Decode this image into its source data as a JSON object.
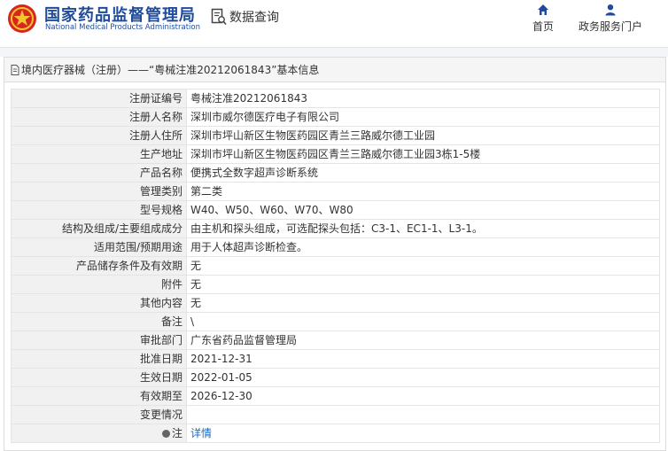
{
  "header": {
    "brand_cn": "国家药品监督管理局",
    "brand_en": "National Medical Products Administration",
    "query_label": "数据查询",
    "nav": [
      {
        "label": "首页",
        "icon": "home-icon"
      },
      {
        "label": "政务服务门户",
        "icon": "user-icon"
      }
    ]
  },
  "colors": {
    "brand": "#1f4b9a",
    "link": "#1a6ac2",
    "label_bg": "#f1f1f1"
  },
  "panel": {
    "title": "境内医疗器械（注册）——“粤械注准20212061843”基本信息"
  },
  "rows": [
    {
      "label": "注册证编号",
      "value": "粤械注准20212061843"
    },
    {
      "label": "注册人名称",
      "value": "深圳市威尔德医疗电子有限公司"
    },
    {
      "label": "注册人住所",
      "value": "深圳市坪山新区生物医药园区青兰三路威尔德工业园"
    },
    {
      "label": "生产地址",
      "value": "深圳市坪山新区生物医药园区青兰三路威尔德工业园3栋1-5楼"
    },
    {
      "label": "产品名称",
      "value": "便携式全数字超声诊断系统"
    },
    {
      "label": "管理类别",
      "value": "第二类"
    },
    {
      "label": "型号规格",
      "value": "W40、W50、W60、W70、W80"
    },
    {
      "label": "结构及组成/主要组成成分",
      "value": "由主机和探头组成，可选配探头包括：C3-1、EC1-1、L3-1。"
    },
    {
      "label": "适用范围/预期用途",
      "value": "用于人体超声诊断检查。"
    },
    {
      "label": "产品储存条件及有效期",
      "value": "无"
    },
    {
      "label": "附件",
      "value": "无"
    },
    {
      "label": "其他内容",
      "value": "无"
    },
    {
      "label": "备注",
      "value": "\\"
    },
    {
      "label": "审批部门",
      "value": "广东省药品监督管理局"
    },
    {
      "label": "批准日期",
      "value": "2021-12-31"
    },
    {
      "label": "生效日期",
      "value": "2022-01-05"
    },
    {
      "label": "有效期至",
      "value": "2026-12-30"
    },
    {
      "label": "变更情况",
      "value": ""
    },
    {
      "label": "注",
      "value": "详情"
    }
  ]
}
